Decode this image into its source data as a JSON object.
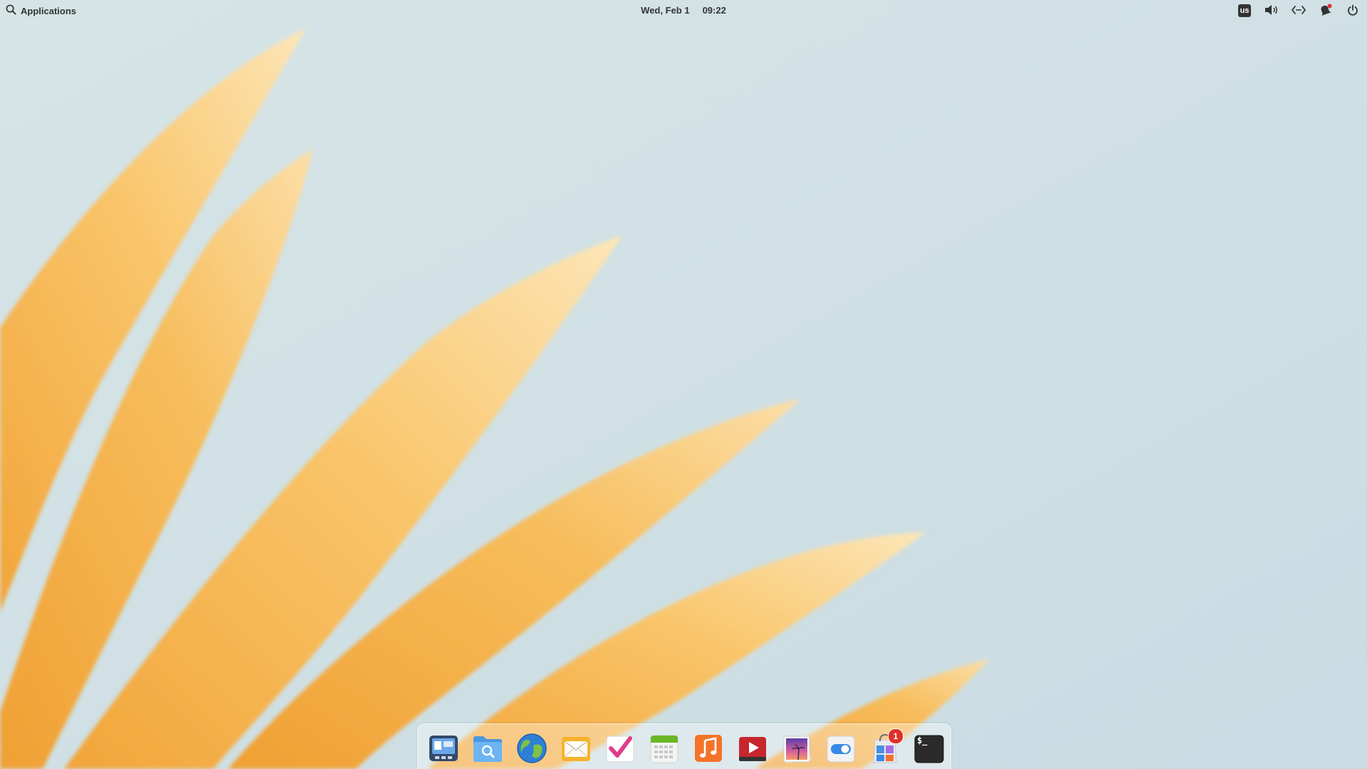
{
  "panel": {
    "applications_label": "Applications",
    "date": "Wed, Feb 1",
    "time": "09:22",
    "keyboard_layout": "us"
  },
  "dock": {
    "apps": [
      {
        "name": "Multitasking View",
        "icon": "multitasking-icon"
      },
      {
        "name": "Files",
        "icon": "files-icon"
      },
      {
        "name": "Web",
        "icon": "web-browser-icon"
      },
      {
        "name": "Mail",
        "icon": "mail-icon"
      },
      {
        "name": "Tasks",
        "icon": "tasks-icon"
      },
      {
        "name": "Calendar",
        "icon": "calendar-icon"
      },
      {
        "name": "Music",
        "icon": "music-icon"
      },
      {
        "name": "Videos",
        "icon": "videos-icon"
      },
      {
        "name": "Photos",
        "icon": "photos-icon"
      },
      {
        "name": "System Settings",
        "icon": "settings-toggle-icon"
      },
      {
        "name": "AppCenter",
        "icon": "appcenter-icon",
        "badge": "1"
      },
      {
        "name": "Terminal",
        "icon": "terminal-icon",
        "prompt": "$_"
      }
    ]
  },
  "colors": {
    "sky": "#d4e3e7",
    "petal": "#f7b84b",
    "petal_light": "#fde3b1",
    "badge": "#e0302a",
    "running_indicator": "#3b8de0"
  }
}
